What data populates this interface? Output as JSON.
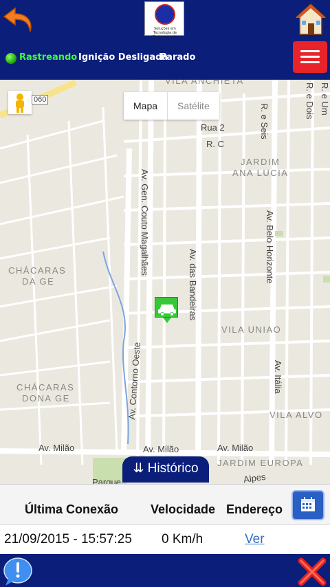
{
  "header": {
    "back_icon": "undo-arrow-icon",
    "logo_text": "Soluções em Tecnologia de Rastreamento",
    "home_icon": "house-icon"
  },
  "status": {
    "tracking": "Rastreando",
    "ignition": "Ignição Desligada",
    "movement": "Parado",
    "tracking_color": "#3cff3c",
    "menu_icon": "hamburger-menu-icon"
  },
  "map": {
    "type_map": "Mapa",
    "type_satellite": "Satélite",
    "highway_shield": "060",
    "labels": {
      "vila_anchieta": "VILA ANCHIETA",
      "rua2": "Rua 2",
      "rc": "R. C",
      "r_seis": "R. e Seis",
      "r_dois": "R. e Dois",
      "r_um": "R. e Um",
      "jardim": "JARDIM",
      "ana_lucia": "ANA LUCIA",
      "av_gen": "Av. Gen. Couto Magalhães",
      "av_bandeiras": "Av. das Bandeiras",
      "av_belo": "Av. Belo Horizonte",
      "chacaras_ge_1": "CHÁCARAS",
      "chacaras_ge_2": "DA GE",
      "vila_uniao": "VILA UNIAO",
      "av_contorno": "Av. Contorno Oeste",
      "av_italia": "Av. Itália",
      "chacaras_dona_1": "CHÁCARAS",
      "chacaras_dona_2": "DONA GE",
      "vila_alvo": "VILA ALVO",
      "av_milao_1": "Av. Milão",
      "av_milao_2": "Av. Milão",
      "av_milao_3": "Av. Milão",
      "jardim_europa": "JARDIM EUROPA",
      "alpes": "Alpes",
      "parque": "Parque"
    },
    "vehicle_icon": "car-marker-icon"
  },
  "history": {
    "tab_label": "Histórico",
    "headers": [
      "Última Conexão",
      "Velocidade",
      "Endereço"
    ],
    "last_connection": "21/09/2015 - 15:57:25",
    "speed": "0 Km/h",
    "address_link": "Ver",
    "calendar_icon": "calendar-icon"
  },
  "footer": {
    "help_icon": "help-bubble-icon",
    "close_icon": "red-x-close-icon"
  },
  "colors": {
    "brand_blue": "#0a1e7a",
    "menu_red": "#e8242a",
    "marker_green": "#37c837",
    "link_blue": "#2a6ec6"
  }
}
